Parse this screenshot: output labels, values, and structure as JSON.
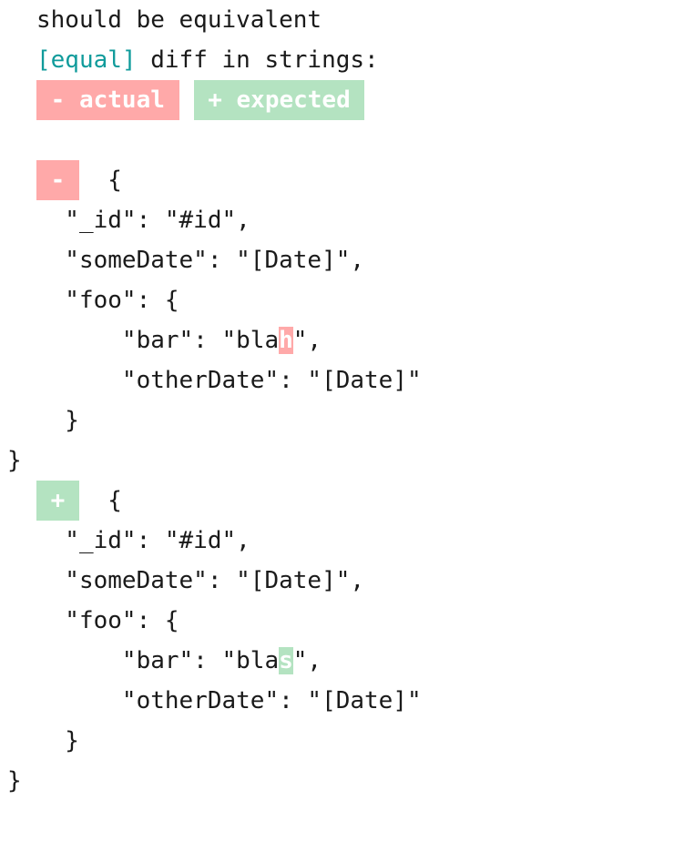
{
  "colors": {
    "background": "#ffffff",
    "text": "#1a1a1a",
    "tag": "#109b9b",
    "removed_bg": "#ffa9a9",
    "added_bg": "#b4e3c1",
    "marker_text": "#ffffff"
  },
  "header": {
    "assertion_text": "should be equivalent",
    "tag": "[equal]",
    "tag_message": " diff in strings:"
  },
  "legend": {
    "actual_label": " - actual ",
    "expected_label": " + expected "
  },
  "actual_block": {
    "marker": "-",
    "open_brace": "{",
    "lines": [
      "  \"_id\": \"#id\",",
      "  \"someDate\": \"[Date]\",",
      "  \"foo\": {"
    ],
    "bar_prefix": "      \"bar\": \"bla",
    "bar_highlight": "h",
    "bar_suffix": "\",",
    "other_date_line": "      \"otherDate\": \"[Date]\"",
    "inner_close": "  }",
    "outer_close": "}"
  },
  "expected_block": {
    "marker": "+",
    "open_brace": "{",
    "lines": [
      "  \"_id\": \"#id\",",
      "  \"someDate\": \"[Date]\",",
      "  \"foo\": {"
    ],
    "bar_prefix": "      \"bar\": \"bla",
    "bar_highlight": "s",
    "bar_suffix": "\",",
    "other_date_line": "      \"otherDate\": \"[Date]\"",
    "inner_close": "  }",
    "outer_close": "}"
  }
}
